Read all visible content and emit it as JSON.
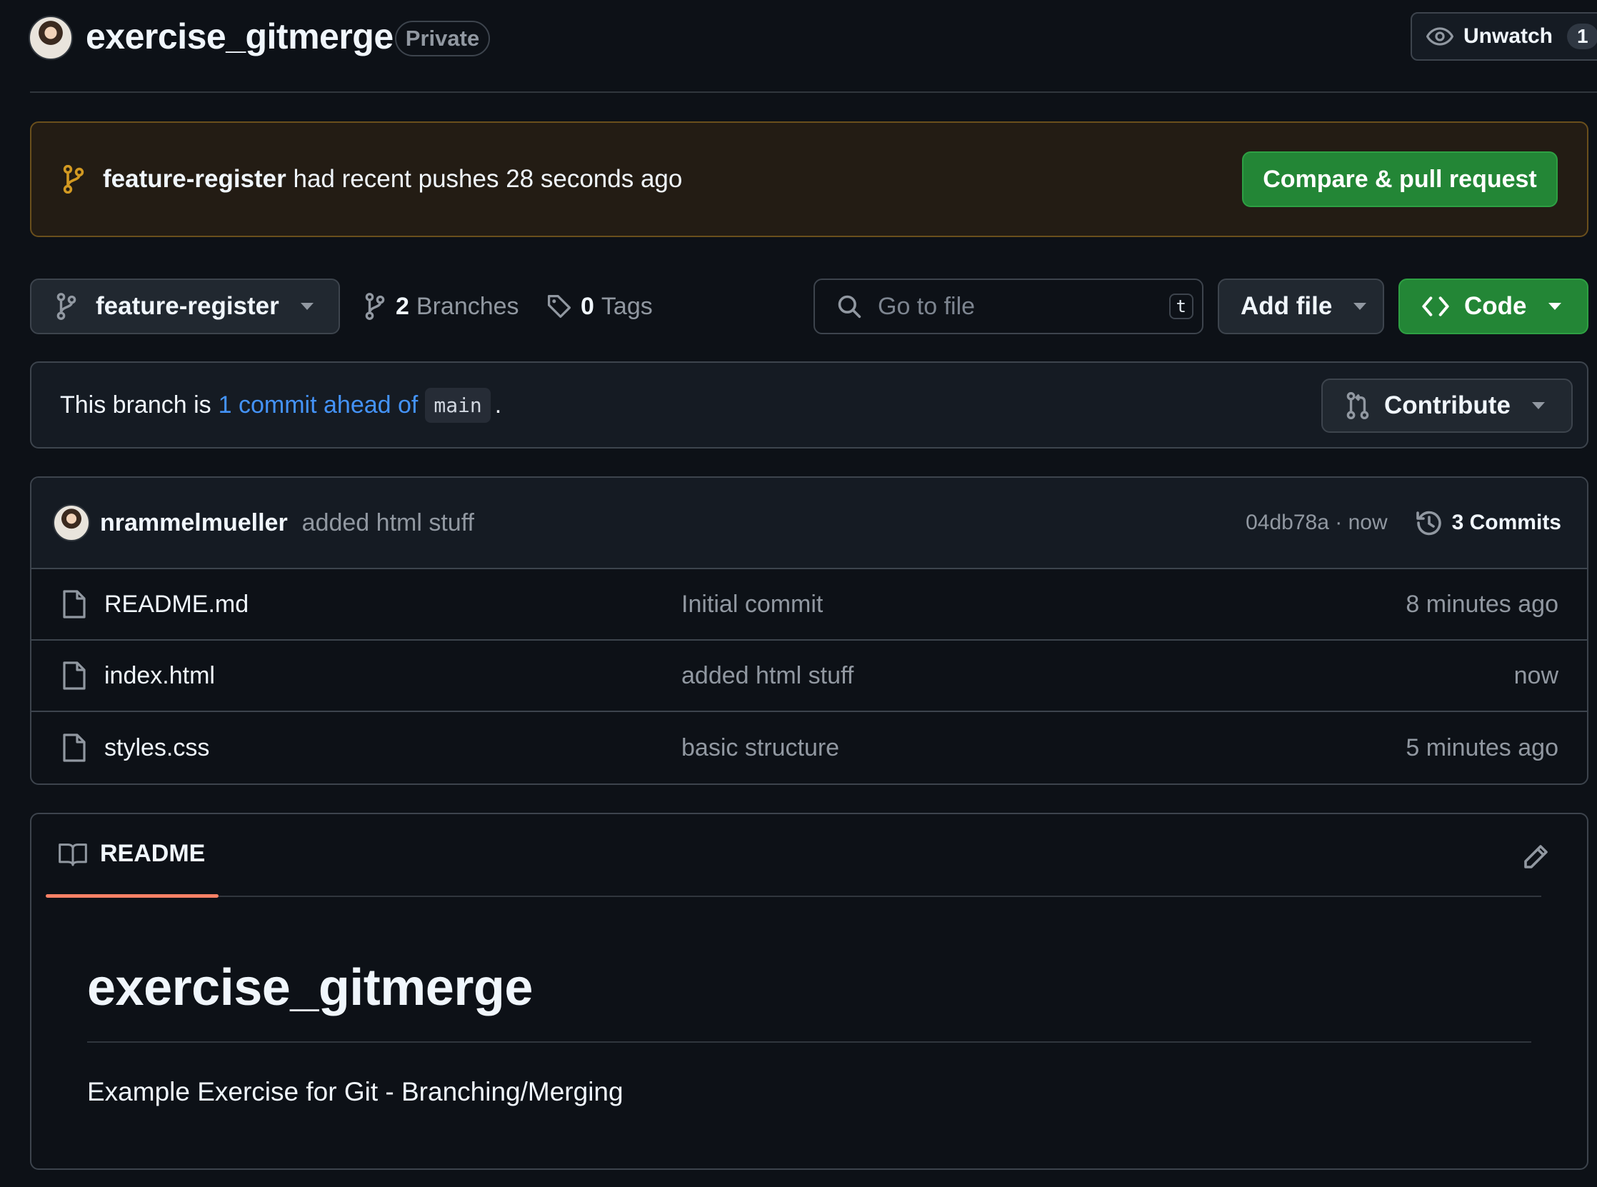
{
  "repo": {
    "name": "exercise_gitmerge",
    "visibility": "Private"
  },
  "watch": {
    "label": "Unwatch",
    "count": "1"
  },
  "banner": {
    "branch": "feature-register",
    "text": "had recent pushes 28 seconds ago",
    "button": "Compare & pull request"
  },
  "toolbar": {
    "branch_select": "feature-register",
    "branches_count": "2",
    "branches_label": "Branches",
    "tags_count": "0",
    "tags_label": "Tags",
    "search_placeholder": "Go to file",
    "search_shortcut": "t",
    "add_file": "Add file",
    "code": "Code"
  },
  "branch_status": {
    "prefix": "This branch is",
    "link": "1 commit ahead of",
    "base": "main",
    "suffix": ".",
    "contribute": "Contribute"
  },
  "latest_commit": {
    "author": "nrammelmueller",
    "message": "added html stuff",
    "meta": "04db78a · now",
    "commits_label": "3 Commits"
  },
  "files": [
    {
      "name": "README.md",
      "commit": "Initial commit",
      "time": "8 minutes ago"
    },
    {
      "name": "index.html",
      "commit": "added html stuff",
      "time": "now"
    },
    {
      "name": "styles.css",
      "commit": "basic structure",
      "time": "5 minutes ago"
    }
  ],
  "readme": {
    "tab": "README",
    "heading": "exercise_gitmerge",
    "body": "Example Exercise for Git - Branching/Merging"
  },
  "colors": {
    "background": "#0d1117",
    "accent_green": "#238636",
    "link_blue": "#4493f8",
    "readme_tab_underline": "#f78166"
  }
}
